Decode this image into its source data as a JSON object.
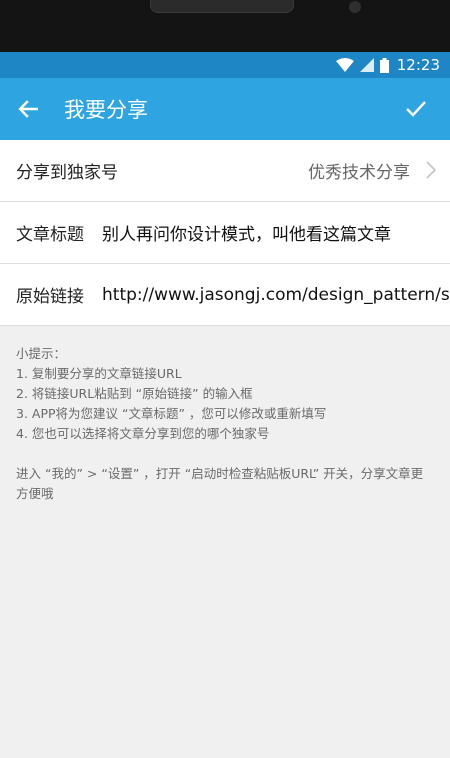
{
  "status_bar": {
    "time": "12:23"
  },
  "app_bar": {
    "title": "我要分享"
  },
  "form": {
    "channel": {
      "label": "分享到独家号",
      "value": "优秀技术分享"
    },
    "article_title": {
      "label": "文章标题",
      "value": "别人再问你设计模式，叫他看这篇文章"
    },
    "original_link": {
      "label": "原始链接",
      "value": "http://www.jasongj.com/design_pattern/summary/"
    }
  },
  "tips": {
    "heading": "小提示：",
    "items": [
      "1. 复制要分享的文章链接URL",
      "2. 将链接URL粘贴到 “原始链接” 的输入框",
      "3. APP将为您建议 “文章标题” ，您可以修改或重新填写",
      "4. 您也可以选择将文章分享到您的哪个独家号"
    ],
    "footer": "进入 “我的” > “设置” ，打开 “启动时检查粘贴板URL” 开关，分享文章更方便哦"
  }
}
